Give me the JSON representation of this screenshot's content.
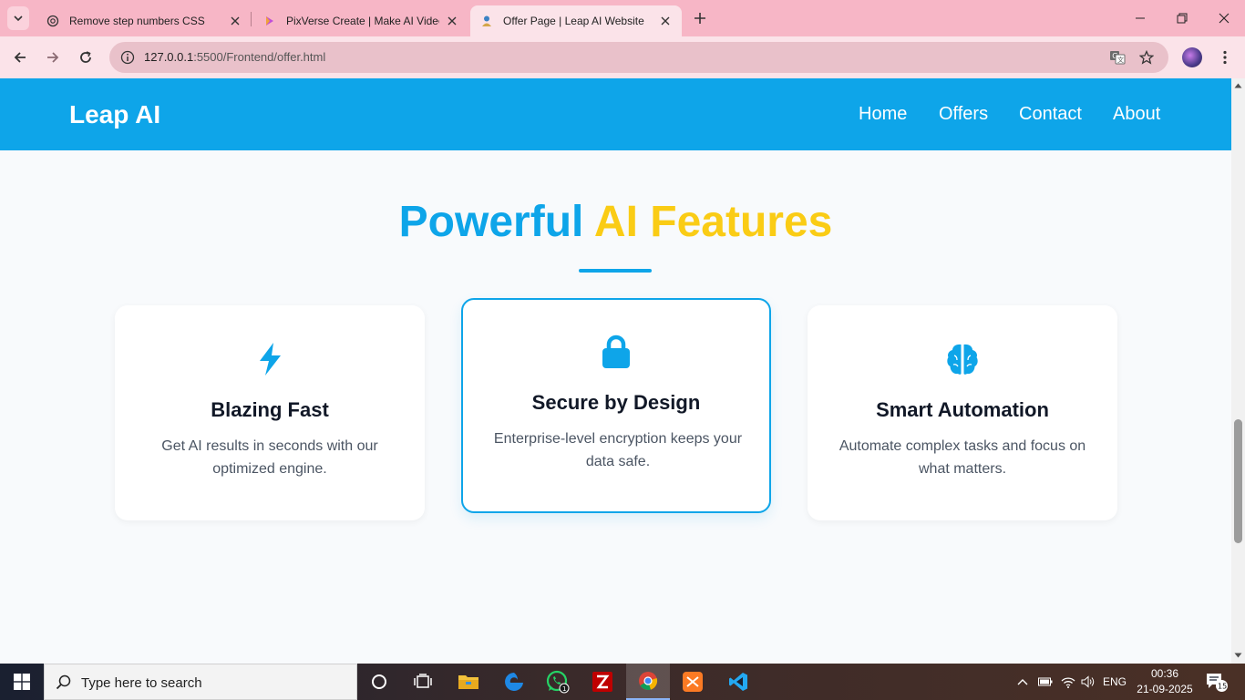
{
  "browser": {
    "tabs": [
      {
        "title": "Remove step numbers CSS",
        "icon": "chatgpt-icon"
      },
      {
        "title": "PixVerse Create | Make AI Video",
        "icon": "pixverse-icon"
      },
      {
        "title": "Offer Page | Leap AI Website",
        "icon": "leap-ai-icon",
        "active": true
      }
    ],
    "url_host": "127.0.0.1",
    "url_path": ":5500/Frontend/offer.html"
  },
  "site": {
    "brand": "Leap AI",
    "nav": [
      "Home",
      "Offers",
      "Contact",
      "About"
    ],
    "section_title_part1": "Powerful",
    "section_title_part2": "AI Features",
    "features": [
      {
        "icon": "lightning-bolt-icon",
        "title": "Blazing Fast",
        "text": "Get AI results in seconds with our optimized engine."
      },
      {
        "icon": "lock-icon",
        "title": "Secure by Design",
        "text": "Enterprise-level encryption keeps your data safe.",
        "featured": true
      },
      {
        "icon": "brain-icon",
        "title": "Smart Automation",
        "text": "Automate complex tasks and focus on what matters."
      }
    ],
    "colors": {
      "primary": "#0ea5e9",
      "accent": "#facc15"
    }
  },
  "taskbar": {
    "search_placeholder": "Type here to search",
    "whatsapp_badge": "1",
    "language": "ENG",
    "time": "00:36",
    "date": "21-09-2025",
    "notification_count": "15"
  }
}
